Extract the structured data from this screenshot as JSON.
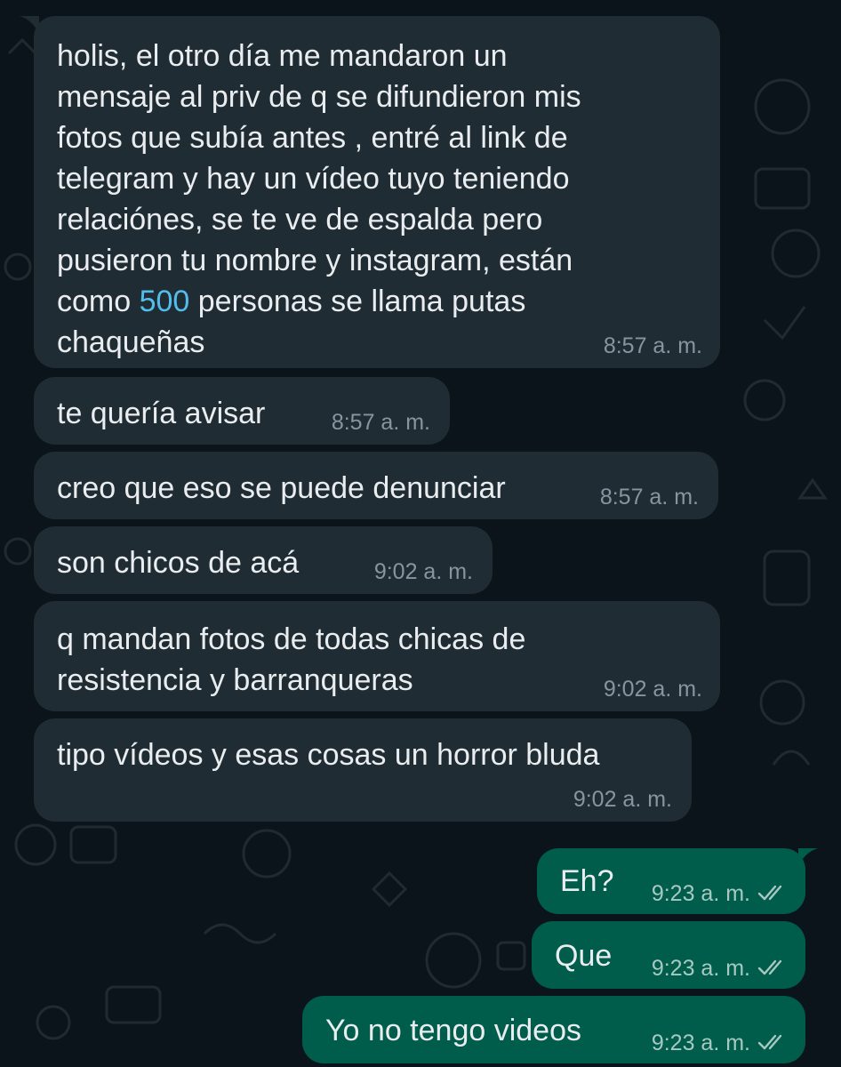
{
  "colors": {
    "background": "#0b141a",
    "incoming_bubble": "#202c33",
    "outgoing_bubble": "#005c4b",
    "text": "#e9edef",
    "timestamp_in": "#8696a0",
    "timestamp_out": "#a7c9c1",
    "link": "#53bdeb"
  },
  "messages": [
    {
      "direction": "incoming",
      "text_before": "holis, el otro día me mandaron un\nmensaje al priv de q se difundieron mis\nfotos que subía antes , entré al link de\ntelegram y hay un vídeo tuyo teniendo\nrelaciónes, se te ve de espalda pero\npusieron tu nombre y instagram, están\ncomo ",
      "highlight": "500",
      "text_after": " personas se llama putas\nchaqueñas",
      "time": "8:57 a. m."
    },
    {
      "direction": "incoming",
      "text": "te quería avisar",
      "time": "8:57 a. m."
    },
    {
      "direction": "incoming",
      "text": "creo que eso se puede denunciar",
      "time": "8:57 a. m."
    },
    {
      "direction": "incoming",
      "text": "son chicos de acá",
      "time": "9:02 a. m."
    },
    {
      "direction": "incoming",
      "text": "q mandan fotos de todas chicas de\nresistencia y barranqueras",
      "time": "9:02 a. m."
    },
    {
      "direction": "incoming",
      "text": "tipo vídeos y esas cosas un horror bluda",
      "time": "9:02 a. m."
    },
    {
      "direction": "outgoing",
      "text": "Eh?",
      "time": "9:23 a. m.",
      "status": "read-double-check-icon"
    },
    {
      "direction": "outgoing",
      "text": "Que",
      "time": "9:23 a. m.",
      "status": "read-double-check-icon"
    },
    {
      "direction": "outgoing",
      "text": "Yo no tengo videos",
      "time": "9:23 a. m.",
      "status": "read-double-check-icon"
    }
  ]
}
